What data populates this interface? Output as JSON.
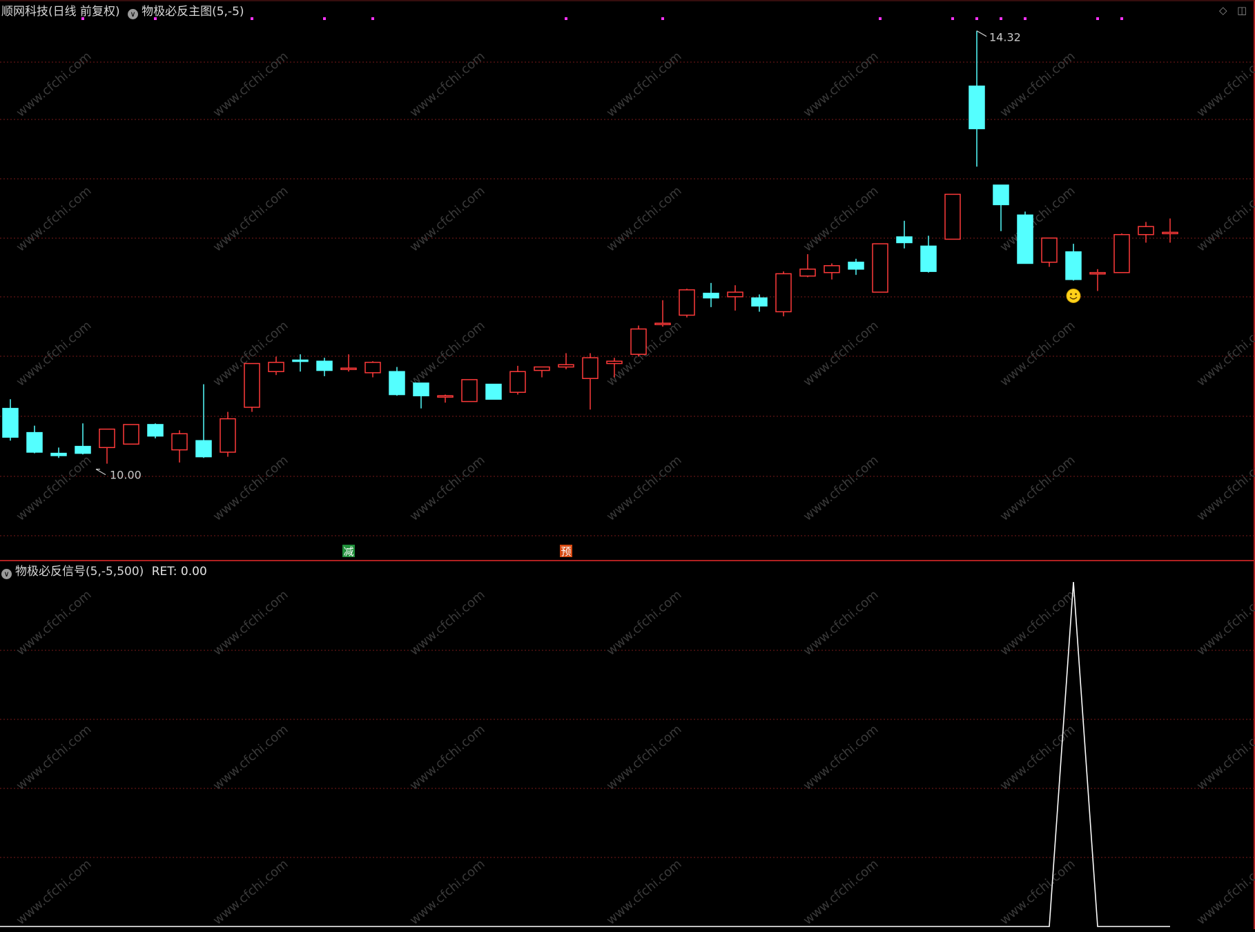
{
  "main_panel": {
    "stock_title": "顺网科技(日线 前复权)",
    "indicator_title": "物极必反主图(5,-5)",
    "max_label": "14.32",
    "min_label": "10.00",
    "signal_reduce": "减",
    "signal_pre": "预"
  },
  "sub_panel": {
    "indicator_title": "物极必反信号(5,-5,500)",
    "ret_label": "RET: 0.00"
  },
  "watermark": "www.cfchi.com",
  "colors": {
    "background": "#000000",
    "up": "#ff3a3a",
    "down": "#54ffff",
    "grid": "#7a1a1a",
    "dots": "#ff33ff",
    "signal_line": "#ffffff",
    "reduce_bg": "#1f8f3a",
    "pre_bg": "#d84a12"
  },
  "chart_data": [
    {
      "type": "candlestick",
      "title": "物极必反主图(5,-5)",
      "ohlc": [
        [
          11.03,
          11.11,
          10.75,
          10.78
        ],
        [
          10.82,
          10.88,
          10.64,
          10.65
        ],
        [
          10.64,
          10.69,
          10.6,
          10.62
        ],
        [
          10.7,
          10.9,
          10.63,
          10.64
        ],
        [
          10.69,
          10.85,
          10.55,
          10.85
        ],
        [
          10.72,
          10.89,
          10.72,
          10.89
        ],
        [
          10.89,
          10.9,
          10.77,
          10.79
        ],
        [
          10.67,
          10.84,
          10.56,
          10.81
        ],
        [
          10.75,
          11.24,
          10.6,
          10.61
        ],
        [
          10.65,
          11.0,
          10.61,
          10.94
        ],
        [
          11.04,
          11.42,
          11.0,
          11.42
        ],
        [
          11.35,
          11.48,
          11.32,
          11.43
        ],
        [
          11.45,
          11.5,
          11.35,
          11.44
        ],
        [
          11.44,
          11.47,
          11.31,
          11.36
        ],
        [
          11.37,
          11.5,
          11.35,
          11.38
        ],
        [
          11.34,
          11.44,
          11.3,
          11.43
        ],
        [
          11.35,
          11.39,
          11.14,
          11.15
        ],
        [
          11.25,
          11.25,
          11.03,
          11.14
        ],
        [
          11.14,
          11.15,
          11.08,
          11.14
        ],
        [
          11.09,
          11.28,
          11.09,
          11.28
        ],
        [
          11.24,
          11.24,
          11.11,
          11.11
        ],
        [
          11.17,
          11.4,
          11.15,
          11.35
        ],
        [
          11.36,
          11.39,
          11.3,
          11.39
        ],
        [
          11.39,
          11.51,
          11.37,
          11.41
        ],
        [
          11.29,
          11.51,
          11.02,
          11.47
        ],
        [
          11.42,
          11.47,
          11.3,
          11.44
        ],
        [
          11.5,
          11.75,
          11.48,
          11.72
        ],
        [
          11.76,
          11.97,
          11.74,
          11.77
        ],
        [
          11.84,
          12.07,
          11.82,
          12.06
        ],
        [
          12.03,
          12.12,
          11.91,
          11.99
        ],
        [
          12.0,
          12.1,
          11.88,
          12.04
        ],
        [
          11.99,
          12.02,
          11.87,
          11.92
        ],
        [
          11.87,
          12.22,
          11.83,
          12.2
        ],
        [
          12.18,
          12.37,
          12.17,
          12.24
        ],
        [
          12.21,
          12.29,
          12.15,
          12.27
        ],
        [
          12.3,
          12.33,
          12.19,
          12.24
        ],
        [
          12.04,
          12.46,
          12.04,
          12.46
        ],
        [
          12.52,
          12.66,
          12.42,
          12.47
        ],
        [
          12.44,
          12.53,
          12.21,
          12.22
        ],
        [
          12.5,
          12.89,
          12.5,
          12.89
        ],
        [
          13.83,
          14.31,
          13.13,
          13.46
        ],
        [
          12.97,
          12.97,
          12.57,
          12.8
        ],
        [
          12.71,
          12.74,
          12.37,
          12.29
        ],
        [
          12.3,
          12.5,
          12.26,
          12.51
        ],
        [
          12.39,
          12.46,
          12.14,
          12.15
        ],
        [
          12.2,
          12.24,
          12.05,
          12.21
        ],
        [
          12.21,
          12.55,
          12.21,
          12.54
        ],
        [
          12.54,
          12.65,
          12.47,
          12.61
        ],
        [
          12.56,
          12.68,
          12.47,
          12.56
        ]
      ],
      "max_price": 14.32,
      "min_price": 10.0,
      "annotations": [
        {
          "text": "减",
          "bar": 14
        },
        {
          "text": "预",
          "bar": 23
        },
        {
          "symbol": "smiley",
          "bar": 44
        }
      ],
      "top_dot_bars": [
        3,
        6,
        10,
        13,
        15,
        23,
        27,
        36,
        39,
        40,
        41,
        42,
        45,
        46
      ],
      "grid": true
    },
    {
      "type": "line",
      "title": "物极必反信号(5,-5,500)",
      "x": [
        0,
        43,
        44,
        45,
        48
      ],
      "y": [
        0,
        0,
        500,
        0,
        0
      ],
      "ylim": [
        0,
        500
      ],
      "grid": true
    }
  ]
}
